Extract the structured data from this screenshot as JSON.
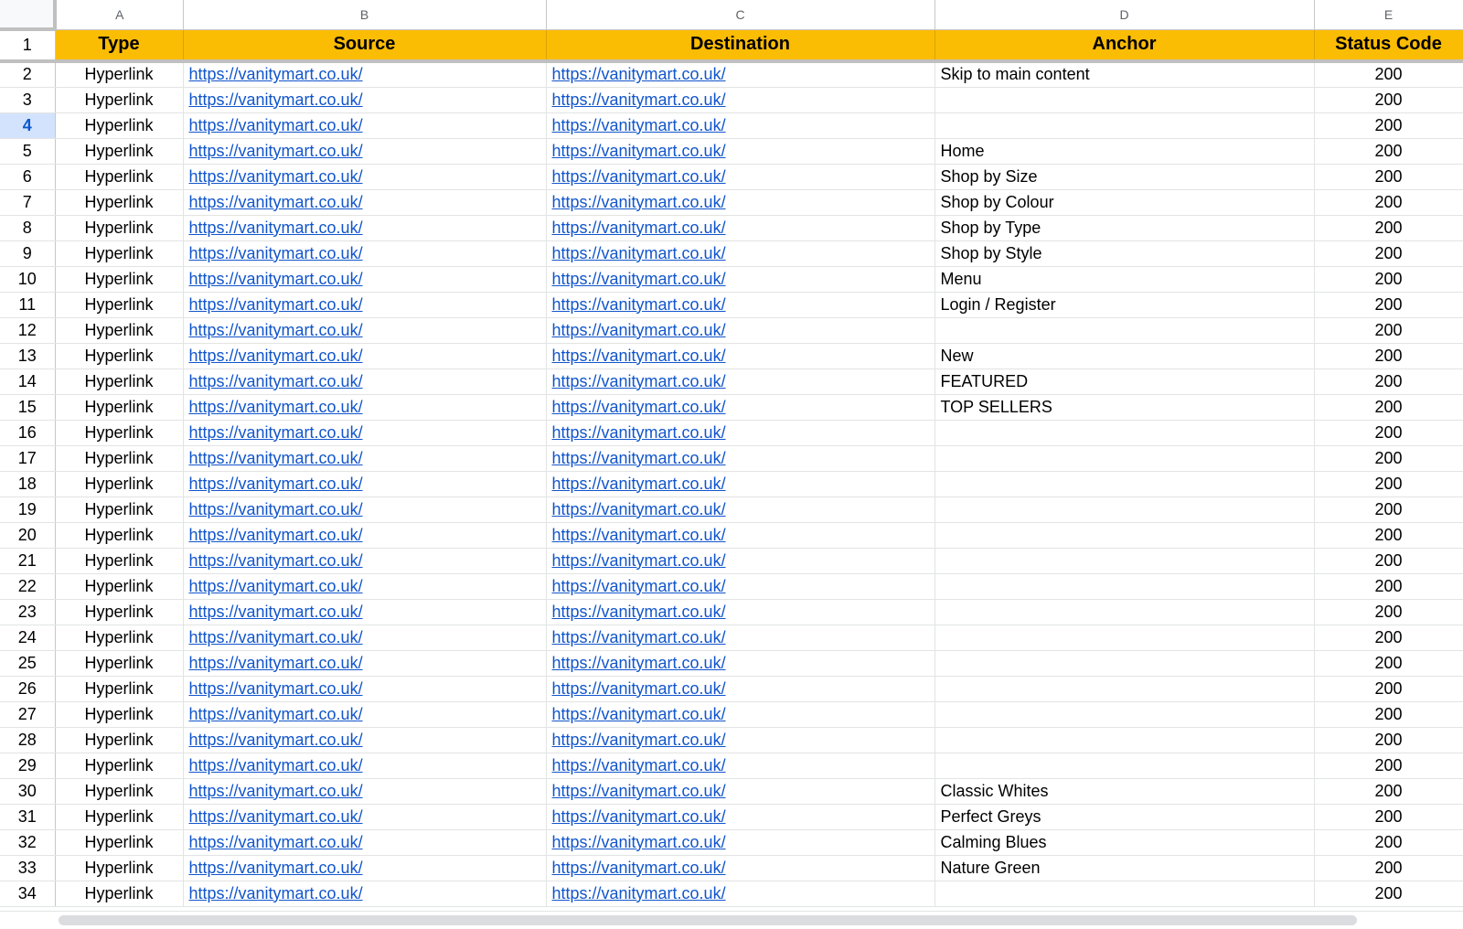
{
  "columns": {
    "letters": [
      "A",
      "B",
      "C",
      "D",
      "E"
    ],
    "headers": [
      "Type",
      "Source",
      "Destination",
      "Anchor",
      "Status Code"
    ]
  },
  "active_row": 4,
  "colors": {
    "header_fill": "#fbbc04",
    "link": "#1155cc",
    "active_row_highlight": "#d3e3fd"
  },
  "rows": [
    {
      "num": "2",
      "type": "Hyperlink",
      "source": "https://vanitymart.co.uk/",
      "destination": "https://vanitymart.co.uk/",
      "anchor": "Skip to main content",
      "status": "200"
    },
    {
      "num": "3",
      "type": "Hyperlink",
      "source": "https://vanitymart.co.uk/",
      "destination": "https://vanitymart.co.uk/",
      "anchor": "",
      "status": "200"
    },
    {
      "num": "4",
      "type": "Hyperlink",
      "source": "https://vanitymart.co.uk/",
      "destination": "https://vanitymart.co.uk/",
      "anchor": "",
      "status": "200"
    },
    {
      "num": "5",
      "type": "Hyperlink",
      "source": "https://vanitymart.co.uk/",
      "destination": "https://vanitymart.co.uk/",
      "anchor": "Home",
      "status": "200"
    },
    {
      "num": "6",
      "type": "Hyperlink",
      "source": "https://vanitymart.co.uk/",
      "destination": "https://vanitymart.co.uk/",
      "anchor": "Shop by Size",
      "status": "200"
    },
    {
      "num": "7",
      "type": "Hyperlink",
      "source": "https://vanitymart.co.uk/",
      "destination": "https://vanitymart.co.uk/",
      "anchor": "Shop by Colour",
      "status": "200"
    },
    {
      "num": "8",
      "type": "Hyperlink",
      "source": "https://vanitymart.co.uk/",
      "destination": "https://vanitymart.co.uk/",
      "anchor": "Shop by Type",
      "status": "200"
    },
    {
      "num": "9",
      "type": "Hyperlink",
      "source": "https://vanitymart.co.uk/",
      "destination": "https://vanitymart.co.uk/",
      "anchor": "Shop by Style",
      "status": "200"
    },
    {
      "num": "10",
      "type": "Hyperlink",
      "source": "https://vanitymart.co.uk/",
      "destination": "https://vanitymart.co.uk/",
      "anchor": "Menu",
      "status": "200"
    },
    {
      "num": "11",
      "type": "Hyperlink",
      "source": "https://vanitymart.co.uk/",
      "destination": "https://vanitymart.co.uk/",
      "anchor": "Login / Register",
      "status": "200"
    },
    {
      "num": "12",
      "type": "Hyperlink",
      "source": "https://vanitymart.co.uk/",
      "destination": "https://vanitymart.co.uk/",
      "anchor": "",
      "status": "200"
    },
    {
      "num": "13",
      "type": "Hyperlink",
      "source": "https://vanitymart.co.uk/",
      "destination": "https://vanitymart.co.uk/",
      "anchor": "New",
      "status": "200"
    },
    {
      "num": "14",
      "type": "Hyperlink",
      "source": "https://vanitymart.co.uk/",
      "destination": "https://vanitymart.co.uk/",
      "anchor": "FEATURED",
      "status": "200"
    },
    {
      "num": "15",
      "type": "Hyperlink",
      "source": "https://vanitymart.co.uk/",
      "destination": "https://vanitymart.co.uk/",
      "anchor": "TOP SELLERS",
      "status": "200"
    },
    {
      "num": "16",
      "type": "Hyperlink",
      "source": "https://vanitymart.co.uk/",
      "destination": "https://vanitymart.co.uk/",
      "anchor": "",
      "status": "200"
    },
    {
      "num": "17",
      "type": "Hyperlink",
      "source": "https://vanitymart.co.uk/",
      "destination": "https://vanitymart.co.uk/",
      "anchor": "",
      "status": "200"
    },
    {
      "num": "18",
      "type": "Hyperlink",
      "source": "https://vanitymart.co.uk/",
      "destination": "https://vanitymart.co.uk/",
      "anchor": "",
      "status": "200"
    },
    {
      "num": "19",
      "type": "Hyperlink",
      "source": "https://vanitymart.co.uk/",
      "destination": "https://vanitymart.co.uk/",
      "anchor": "",
      "status": "200"
    },
    {
      "num": "20",
      "type": "Hyperlink",
      "source": "https://vanitymart.co.uk/",
      "destination": "https://vanitymart.co.uk/",
      "anchor": "",
      "status": "200"
    },
    {
      "num": "21",
      "type": "Hyperlink",
      "source": "https://vanitymart.co.uk/",
      "destination": "https://vanitymart.co.uk/",
      "anchor": "",
      "status": "200"
    },
    {
      "num": "22",
      "type": "Hyperlink",
      "source": "https://vanitymart.co.uk/",
      "destination": "https://vanitymart.co.uk/",
      "anchor": "",
      "status": "200"
    },
    {
      "num": "23",
      "type": "Hyperlink",
      "source": "https://vanitymart.co.uk/",
      "destination": "https://vanitymart.co.uk/",
      "anchor": "",
      "status": "200"
    },
    {
      "num": "24",
      "type": "Hyperlink",
      "source": "https://vanitymart.co.uk/",
      "destination": "https://vanitymart.co.uk/",
      "anchor": "",
      "status": "200"
    },
    {
      "num": "25",
      "type": "Hyperlink",
      "source": "https://vanitymart.co.uk/",
      "destination": "https://vanitymart.co.uk/",
      "anchor": "",
      "status": "200"
    },
    {
      "num": "26",
      "type": "Hyperlink",
      "source": "https://vanitymart.co.uk/",
      "destination": "https://vanitymart.co.uk/",
      "anchor": "",
      "status": "200"
    },
    {
      "num": "27",
      "type": "Hyperlink",
      "source": "https://vanitymart.co.uk/",
      "destination": "https://vanitymart.co.uk/",
      "anchor": "",
      "status": "200"
    },
    {
      "num": "28",
      "type": "Hyperlink",
      "source": "https://vanitymart.co.uk/",
      "destination": "https://vanitymart.co.uk/",
      "anchor": "",
      "status": "200"
    },
    {
      "num": "29",
      "type": "Hyperlink",
      "source": "https://vanitymart.co.uk/",
      "destination": "https://vanitymart.co.uk/",
      "anchor": "",
      "status": "200"
    },
    {
      "num": "30",
      "type": "Hyperlink",
      "source": "https://vanitymart.co.uk/",
      "destination": "https://vanitymart.co.uk/",
      "anchor": "Classic Whites",
      "status": "200"
    },
    {
      "num": "31",
      "type": "Hyperlink",
      "source": "https://vanitymart.co.uk/",
      "destination": "https://vanitymart.co.uk/",
      "anchor": "Perfect Greys",
      "status": "200"
    },
    {
      "num": "32",
      "type": "Hyperlink",
      "source": "https://vanitymart.co.uk/",
      "destination": "https://vanitymart.co.uk/",
      "anchor": "Calming Blues",
      "status": "200"
    },
    {
      "num": "33",
      "type": "Hyperlink",
      "source": "https://vanitymart.co.uk/",
      "destination": "https://vanitymart.co.uk/",
      "anchor": "Nature Green",
      "status": "200"
    },
    {
      "num": "34",
      "type": "Hyperlink",
      "source": "https://vanitymart.co.uk/",
      "destination": "https://vanitymart.co.uk/",
      "anchor": "",
      "status": "200"
    }
  ]
}
